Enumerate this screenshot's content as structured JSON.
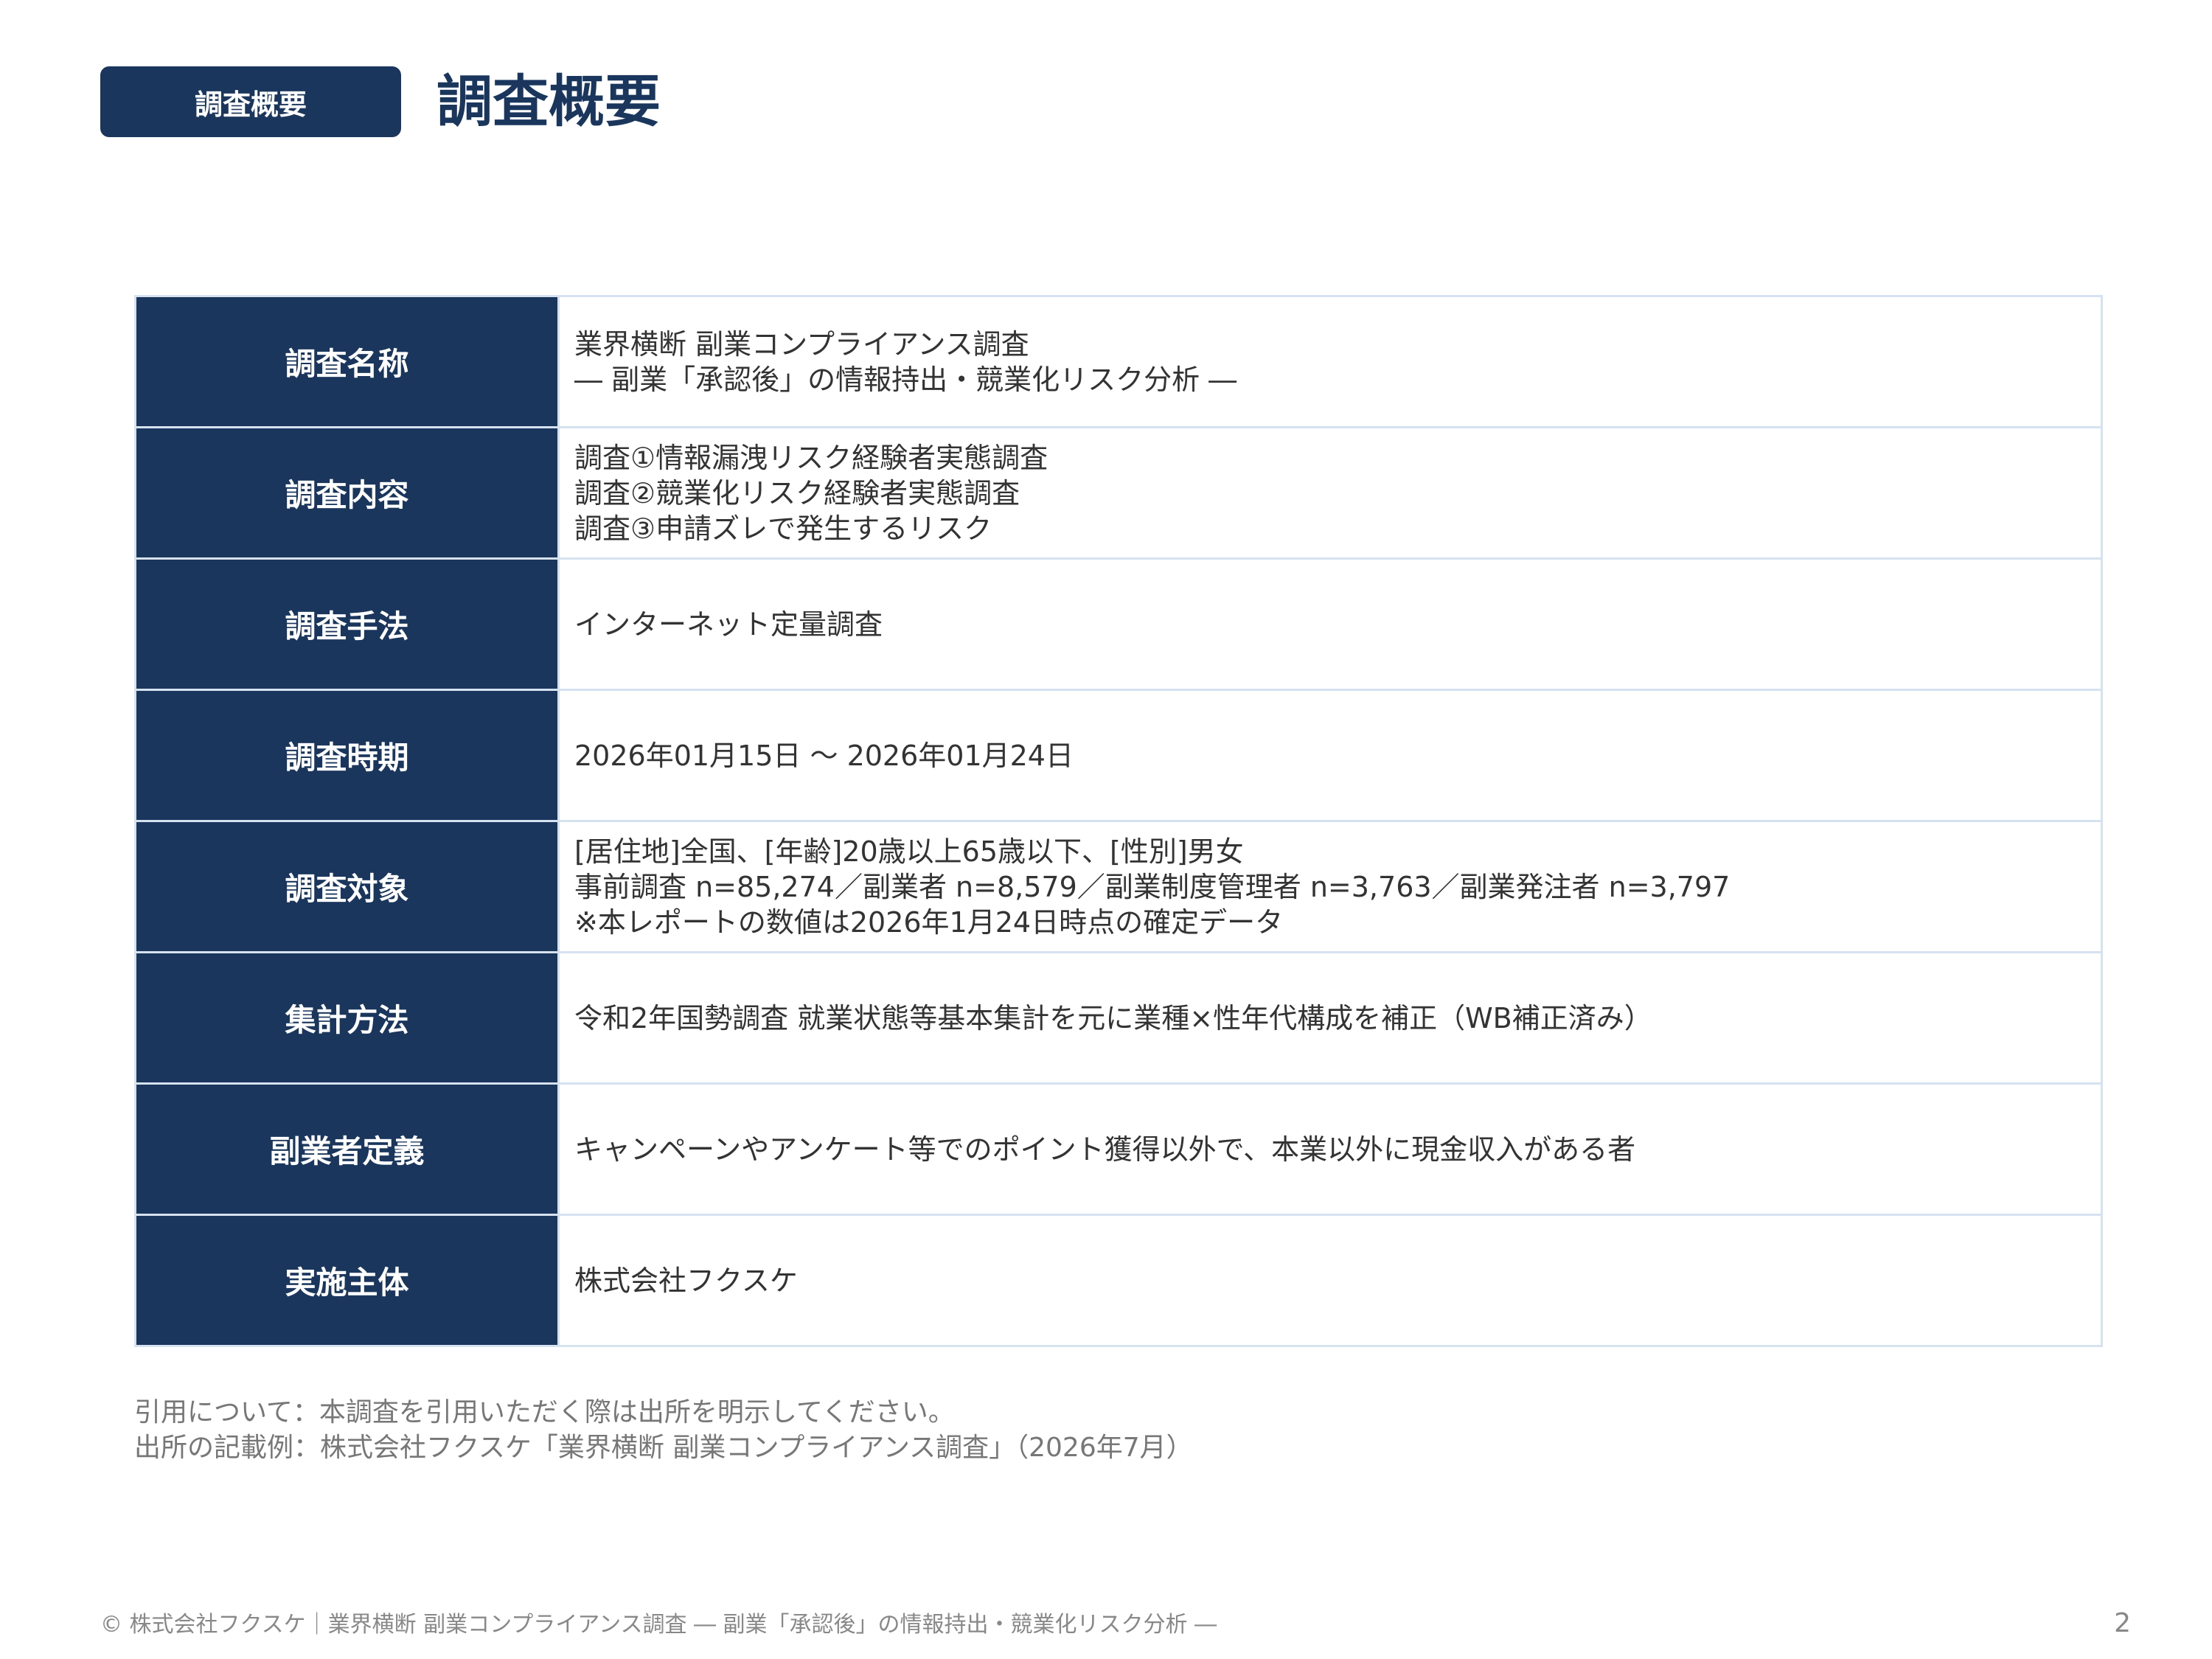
{
  "header": {
    "badge_label": "調査概要",
    "title": "調査概要"
  },
  "table": {
    "rows": [
      {
        "label": "調査名称",
        "lines": [
          "業界横断 副業コンプライアンス調査",
          "― 副業「承認後」の情報持出・競業化リスク分析 ―"
        ]
      },
      {
        "label": "調査内容",
        "lines": [
          "調査①情報漏洩リスク経験者実態調査",
          "調査②競業化リスク経験者実態調査",
          "調査③申請ズレで発生するリスク"
        ]
      },
      {
        "label": "調査手法",
        "lines": [
          "インターネット定量調査"
        ]
      },
      {
        "label": "調査時期",
        "lines": [
          "2026年01月15日 〜 2026年01月24日"
        ]
      },
      {
        "label": "調査対象",
        "lines": [
          "[居住地]全国、[年齢]20歳以上65歳以下、[性別]男女",
          "事前調査 n=85,274／副業者 n=8,579／副業制度管理者 n=3,763／副業発注者 n=3,797",
          "※本レポートの数値は2026年1月24日時点の確定データ"
        ]
      },
      {
        "label": "集計方法",
        "lines": [
          "令和2年国勢調査 就業状態等基本集計を元に業種×性年代構成を補正（WB補正済み）"
        ]
      },
      {
        "label": "副業者定義",
        "lines": [
          "キャンペーンやアンケート等でのポイント獲得以外で、本業以外に現金収入がある者"
        ]
      },
      {
        "label": "実施主体",
        "lines": [
          "株式会社フクスケ"
        ]
      }
    ]
  },
  "citation": {
    "line1": "引用について：本調査を引用いただく際は出所を明示してください。",
    "line2": "出所の記載例：株式会社フクスケ「業界横断 副業コンプライアンス調査」（2026年7月）"
  },
  "footer": {
    "text": "© 株式会社フクスケ｜業界横断 副業コンプライアンス調査 ― 副業「承認後」の情報持出・競業化リスク分析 ―",
    "page_number": "2"
  }
}
